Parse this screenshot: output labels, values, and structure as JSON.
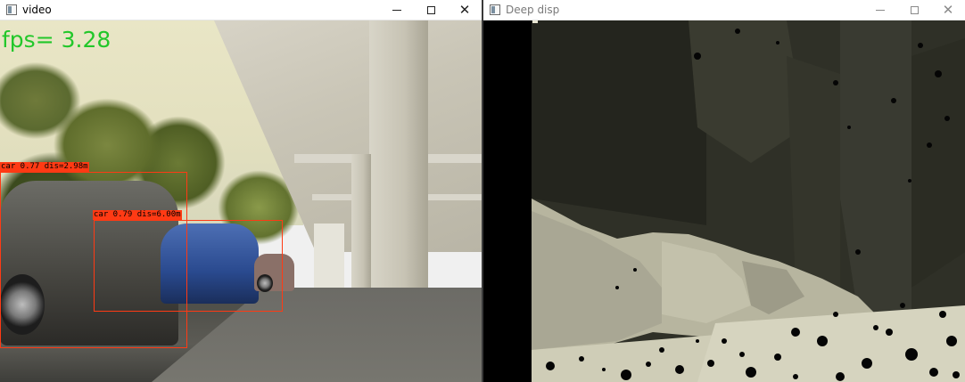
{
  "windows": {
    "video": {
      "title": "video",
      "fps_text": "fps= 3.28",
      "detections": [
        {
          "label": "car 0.77 dis=2.98m"
        },
        {
          "label": "car 0.79 dis=6.00m"
        }
      ]
    },
    "depth": {
      "title": "Deep disp"
    }
  },
  "icons": {
    "app": "app-window-icon",
    "minimize": "minimize-icon",
    "maximize": "maximize-icon",
    "close": "close-icon"
  },
  "colors": {
    "fps_text": "#22c72a",
    "detection_box": "#ff3a14",
    "depth_dark": "#2e2f26",
    "depth_light": "#c9c7b1"
  }
}
